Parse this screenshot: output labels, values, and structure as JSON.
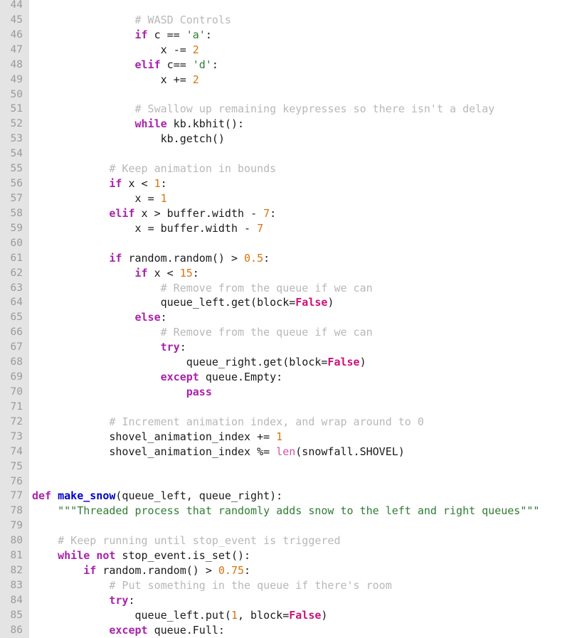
{
  "viewer": {
    "name": "code-listing",
    "language": "Python",
    "first_line_number": 44,
    "last_line_number": 86,
    "gutter_background": "#e4e4e4",
    "background": "#ffffff",
    "line_number_color": "#9a9a9a"
  },
  "colors": {
    "keyword": "#aa22aa",
    "function_name": "#0000cc",
    "builtin": "#cc55aa",
    "constant": "#cc1177",
    "number": "#d9730d",
    "string": "#2e7d32",
    "comment": "#b8b8b8",
    "text": "#1a1a1a"
  },
  "lines": [
    {
      "n": "44",
      "tokens": []
    },
    {
      "n": "45",
      "tokens": [
        {
          "t": "plain",
          "s": "                "
        },
        {
          "t": "com",
          "s": "# WASD Controls"
        }
      ]
    },
    {
      "n": "46",
      "tokens": [
        {
          "t": "plain",
          "s": "                "
        },
        {
          "t": "kw",
          "s": "if"
        },
        {
          "t": "plain",
          "s": " c "
        },
        {
          "t": "op",
          "s": "=="
        },
        {
          "t": "plain",
          "s": " "
        },
        {
          "t": "str",
          "s": "'a'"
        },
        {
          "t": "plain",
          "s": ":"
        }
      ]
    },
    {
      "n": "47",
      "tokens": [
        {
          "t": "plain",
          "s": "                    x "
        },
        {
          "t": "op",
          "s": "-="
        },
        {
          "t": "plain",
          "s": " "
        },
        {
          "t": "num",
          "s": "2"
        }
      ]
    },
    {
      "n": "48",
      "tokens": [
        {
          "t": "plain",
          "s": "                "
        },
        {
          "t": "kw",
          "s": "elif"
        },
        {
          "t": "plain",
          "s": " c"
        },
        {
          "t": "op",
          "s": "=="
        },
        {
          "t": "plain",
          "s": " "
        },
        {
          "t": "str",
          "s": "'d'"
        },
        {
          "t": "plain",
          "s": ":"
        }
      ]
    },
    {
      "n": "49",
      "tokens": [
        {
          "t": "plain",
          "s": "                    x "
        },
        {
          "t": "op",
          "s": "+="
        },
        {
          "t": "plain",
          "s": " "
        },
        {
          "t": "num",
          "s": "2"
        }
      ]
    },
    {
      "n": "50",
      "tokens": []
    },
    {
      "n": "51",
      "tokens": [
        {
          "t": "plain",
          "s": "                "
        },
        {
          "t": "com",
          "s": "# Swallow up remaining keypresses so there isn't a delay"
        }
      ]
    },
    {
      "n": "52",
      "tokens": [
        {
          "t": "plain",
          "s": "                "
        },
        {
          "t": "kw",
          "s": "while"
        },
        {
          "t": "plain",
          "s": " kb.kbhit():"
        }
      ]
    },
    {
      "n": "53",
      "tokens": [
        {
          "t": "plain",
          "s": "                    kb.getch()"
        }
      ]
    },
    {
      "n": "54",
      "tokens": []
    },
    {
      "n": "55",
      "tokens": [
        {
          "t": "plain",
          "s": "            "
        },
        {
          "t": "com",
          "s": "# Keep animation in bounds"
        }
      ]
    },
    {
      "n": "56",
      "tokens": [
        {
          "t": "plain",
          "s": "            "
        },
        {
          "t": "kw",
          "s": "if"
        },
        {
          "t": "plain",
          "s": " x "
        },
        {
          "t": "op",
          "s": "<"
        },
        {
          "t": "plain",
          "s": " "
        },
        {
          "t": "num",
          "s": "1"
        },
        {
          "t": "plain",
          "s": ":"
        }
      ]
    },
    {
      "n": "57",
      "tokens": [
        {
          "t": "plain",
          "s": "                x "
        },
        {
          "t": "op",
          "s": "="
        },
        {
          "t": "plain",
          "s": " "
        },
        {
          "t": "num",
          "s": "1"
        }
      ]
    },
    {
      "n": "58",
      "tokens": [
        {
          "t": "plain",
          "s": "            "
        },
        {
          "t": "kw",
          "s": "elif"
        },
        {
          "t": "plain",
          "s": " x "
        },
        {
          "t": "op",
          "s": ">"
        },
        {
          "t": "plain",
          "s": " buffer.width "
        },
        {
          "t": "op",
          "s": "-"
        },
        {
          "t": "plain",
          "s": " "
        },
        {
          "t": "num",
          "s": "7"
        },
        {
          "t": "plain",
          "s": ":"
        }
      ]
    },
    {
      "n": "59",
      "tokens": [
        {
          "t": "plain",
          "s": "                x "
        },
        {
          "t": "op",
          "s": "="
        },
        {
          "t": "plain",
          "s": " buffer.width "
        },
        {
          "t": "op",
          "s": "-"
        },
        {
          "t": "plain",
          "s": " "
        },
        {
          "t": "num",
          "s": "7"
        }
      ]
    },
    {
      "n": "60",
      "tokens": []
    },
    {
      "n": "61",
      "tokens": [
        {
          "t": "plain",
          "s": "            "
        },
        {
          "t": "kw",
          "s": "if"
        },
        {
          "t": "plain",
          "s": " random.random() "
        },
        {
          "t": "op",
          "s": ">"
        },
        {
          "t": "plain",
          "s": " "
        },
        {
          "t": "num",
          "s": "0.5"
        },
        {
          "t": "plain",
          "s": ":"
        }
      ]
    },
    {
      "n": "62",
      "tokens": [
        {
          "t": "plain",
          "s": "                "
        },
        {
          "t": "kw",
          "s": "if"
        },
        {
          "t": "plain",
          "s": " x "
        },
        {
          "t": "op",
          "s": "<"
        },
        {
          "t": "plain",
          "s": " "
        },
        {
          "t": "num",
          "s": "15"
        },
        {
          "t": "plain",
          "s": ":"
        }
      ]
    },
    {
      "n": "63",
      "tokens": [
        {
          "t": "plain",
          "s": "                    "
        },
        {
          "t": "com",
          "s": "# Remove from the queue if we can"
        }
      ]
    },
    {
      "n": "64",
      "tokens": [
        {
          "t": "plain",
          "s": "                    queue_left.get(block"
        },
        {
          "t": "op",
          "s": "="
        },
        {
          "t": "const",
          "s": "False"
        },
        {
          "t": "plain",
          "s": ")"
        }
      ]
    },
    {
      "n": "65",
      "tokens": [
        {
          "t": "plain",
          "s": "                "
        },
        {
          "t": "kw",
          "s": "else"
        },
        {
          "t": "plain",
          "s": ":"
        }
      ]
    },
    {
      "n": "66",
      "tokens": [
        {
          "t": "plain",
          "s": "                    "
        },
        {
          "t": "com",
          "s": "# Remove from the queue if we can"
        }
      ]
    },
    {
      "n": "67",
      "tokens": [
        {
          "t": "plain",
          "s": "                    "
        },
        {
          "t": "kw",
          "s": "try"
        },
        {
          "t": "plain",
          "s": ":"
        }
      ]
    },
    {
      "n": "68",
      "tokens": [
        {
          "t": "plain",
          "s": "                        queue_right.get(block"
        },
        {
          "t": "op",
          "s": "="
        },
        {
          "t": "const",
          "s": "False"
        },
        {
          "t": "plain",
          "s": ")"
        }
      ]
    },
    {
      "n": "69",
      "tokens": [
        {
          "t": "plain",
          "s": "                    "
        },
        {
          "t": "kw",
          "s": "except"
        },
        {
          "t": "plain",
          "s": " queue.Empty:"
        }
      ]
    },
    {
      "n": "70",
      "tokens": [
        {
          "t": "plain",
          "s": "                        "
        },
        {
          "t": "kw",
          "s": "pass"
        }
      ]
    },
    {
      "n": "71",
      "tokens": []
    },
    {
      "n": "72",
      "tokens": [
        {
          "t": "plain",
          "s": "            "
        },
        {
          "t": "com",
          "s": "# Increment animation index, and wrap around to 0"
        }
      ]
    },
    {
      "n": "73",
      "tokens": [
        {
          "t": "plain",
          "s": "            shovel_animation_index "
        },
        {
          "t": "op",
          "s": "+="
        },
        {
          "t": "plain",
          "s": " "
        },
        {
          "t": "num",
          "s": "1"
        }
      ]
    },
    {
      "n": "74",
      "tokens": [
        {
          "t": "plain",
          "s": "            shovel_animation_index "
        },
        {
          "t": "op",
          "s": "%="
        },
        {
          "t": "plain",
          "s": " "
        },
        {
          "t": "builtin",
          "s": "len"
        },
        {
          "t": "plain",
          "s": "(snowfall.SHOVEL)"
        }
      ]
    },
    {
      "n": "75",
      "tokens": []
    },
    {
      "n": "76",
      "tokens": []
    },
    {
      "n": "77",
      "tokens": [
        {
          "t": "def",
          "s": "def"
        },
        {
          "t": "plain",
          "s": " "
        },
        {
          "t": "fname",
          "s": "make_snow"
        },
        {
          "t": "plain",
          "s": "(queue_left, queue_right):"
        }
      ]
    },
    {
      "n": "78",
      "tokens": [
        {
          "t": "plain",
          "s": "    "
        },
        {
          "t": "doc",
          "s": "\"\"\"Threaded process that randomly adds snow to the left and right queues\"\"\""
        }
      ]
    },
    {
      "n": "79",
      "tokens": []
    },
    {
      "n": "80",
      "tokens": [
        {
          "t": "plain",
          "s": "    "
        },
        {
          "t": "com",
          "s": "# Keep running until stop_event is triggered"
        }
      ]
    },
    {
      "n": "81",
      "tokens": [
        {
          "t": "plain",
          "s": "    "
        },
        {
          "t": "kw",
          "s": "while"
        },
        {
          "t": "plain",
          "s": " "
        },
        {
          "t": "kw",
          "s": "not"
        },
        {
          "t": "plain",
          "s": " stop_event.is_set():"
        }
      ]
    },
    {
      "n": "82",
      "tokens": [
        {
          "t": "plain",
          "s": "        "
        },
        {
          "t": "kw",
          "s": "if"
        },
        {
          "t": "plain",
          "s": " random.random() "
        },
        {
          "t": "op",
          "s": ">"
        },
        {
          "t": "plain",
          "s": " "
        },
        {
          "t": "num",
          "s": "0.75"
        },
        {
          "t": "plain",
          "s": ":"
        }
      ]
    },
    {
      "n": "83",
      "tokens": [
        {
          "t": "plain",
          "s": "            "
        },
        {
          "t": "com",
          "s": "# Put something in the queue if there's room"
        }
      ]
    },
    {
      "n": "84",
      "tokens": [
        {
          "t": "plain",
          "s": "            "
        },
        {
          "t": "kw",
          "s": "try"
        },
        {
          "t": "plain",
          "s": ":"
        }
      ]
    },
    {
      "n": "85",
      "tokens": [
        {
          "t": "plain",
          "s": "                queue_left.put("
        },
        {
          "t": "num",
          "s": "1"
        },
        {
          "t": "plain",
          "s": ", block"
        },
        {
          "t": "op",
          "s": "="
        },
        {
          "t": "const",
          "s": "False"
        },
        {
          "t": "plain",
          "s": ")"
        }
      ]
    },
    {
      "n": "86",
      "tokens": [
        {
          "t": "plain",
          "s": "            "
        },
        {
          "t": "kw",
          "s": "except"
        },
        {
          "t": "plain",
          "s": " queue.Full:"
        }
      ]
    }
  ]
}
